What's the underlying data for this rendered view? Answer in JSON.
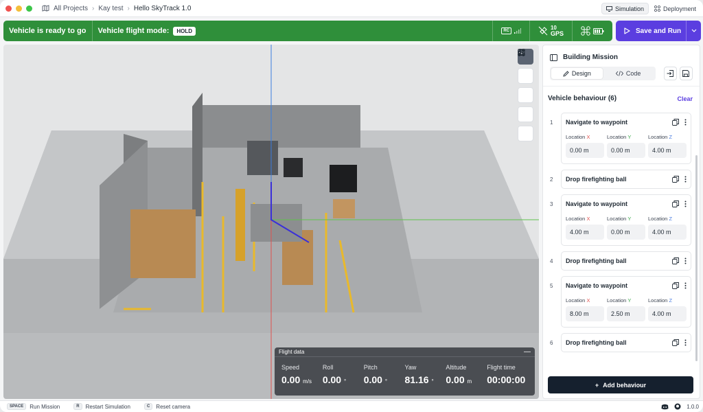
{
  "titlebar": {
    "crumbs": [
      "All Projects",
      "Kay test",
      "Hello SkyTrack 1.0"
    ],
    "modes": [
      "Simulation",
      "Deployment"
    ]
  },
  "status": {
    "ready": "Vehicle is ready to go",
    "mode_label": "Vehicle flight mode:",
    "mode_value": "HOLD",
    "rc": "RC",
    "gps_count": "10",
    "gps_label": "GPS"
  },
  "actions": {
    "save_run": "Save and Run"
  },
  "flight": {
    "title": "Flight data",
    "items": [
      {
        "label": "Speed",
        "value": "0.00",
        "unit": "m/s"
      },
      {
        "label": "Roll",
        "value": "0.00",
        "unit": "°"
      },
      {
        "label": "Pitch",
        "value": "0.00",
        "unit": "°"
      },
      {
        "label": "Yaw",
        "value": "81.16",
        "unit": "°"
      },
      {
        "label": "Altitude",
        "value": "0.00",
        "unit": "m"
      },
      {
        "label": "Flight time",
        "value": "00:00:00",
        "unit": ""
      }
    ]
  },
  "panel": {
    "title": "Building Mission",
    "tab_design": "Design",
    "tab_code": "Code",
    "behaviour_header": "Vehicle behaviour (6)",
    "clear": "Clear",
    "loc_label": "Location",
    "axis_x": "X",
    "axis_y": "Y",
    "axis_z": "Z",
    "behaviours": [
      {
        "num": "1",
        "title": "Navigate to waypoint",
        "x": "0.00 m",
        "y": "0.00 m",
        "z": "4.00 m"
      },
      {
        "num": "2",
        "title": "Drop firefighting ball"
      },
      {
        "num": "3",
        "title": "Navigate to waypoint",
        "x": "4.00 m",
        "y": "0.00 m",
        "z": "4.00 m"
      },
      {
        "num": "4",
        "title": "Drop firefighting ball"
      },
      {
        "num": "5",
        "title": "Navigate to waypoint",
        "x": "8.00 m",
        "y": "2.50 m",
        "z": "4.00 m"
      },
      {
        "num": "6",
        "title": "Drop firefighting ball"
      }
    ],
    "add": "Add behaviour"
  },
  "bottom": {
    "hints": [
      {
        "key": "SPACE",
        "label": "Run Mission"
      },
      {
        "key": "R",
        "label": "Restart Simulation"
      },
      {
        "key": "C",
        "label": "Reset camera"
      }
    ],
    "version": "1.0.0"
  },
  "colors": {
    "status_green": "#2f8f3a",
    "accent": "#5b3ee0",
    "dark": "#15202e"
  }
}
